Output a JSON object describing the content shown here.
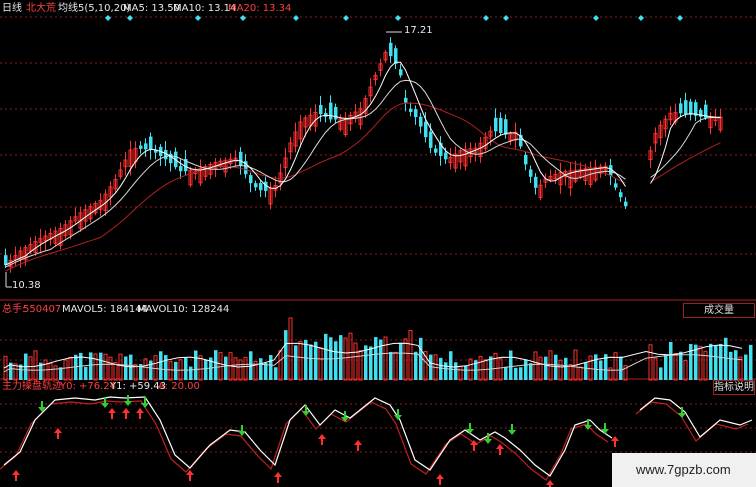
{
  "price_panel": {
    "period": "日线",
    "stock_name": "北大荒",
    "ma_title": "均线5(5,10,20)",
    "ma5": "MA5: 13.50",
    "ma10": "MA10: 13.14",
    "ma20": "MA20: 13.34",
    "high_label": "17.21",
    "low_label": "10.38"
  },
  "volume_panel": {
    "total_label": "总手:",
    "total_value": "550407",
    "mavol5": "MAVOL5: 184144",
    "mavol10": "MAVOL10: 128244",
    "button_label": "成交量"
  },
  "indicator_panel": {
    "title": "主力操盘轨迹",
    "y0": "Y0: +76.24",
    "y1": "Y1: +59.43",
    "a": "A: 20.00",
    "button_label": "指标说明"
  },
  "watermark": "www.7gpzb.com",
  "colors": {
    "up": "#ff3030",
    "down": "#40e0f0",
    "ma5": "#ffffff",
    "ma10": "#d8d8d8",
    "ma20": "#b02020",
    "grid": "#8b1a1a",
    "arrow_up": "#ff3030",
    "arrow_down": "#30d030"
  }
}
